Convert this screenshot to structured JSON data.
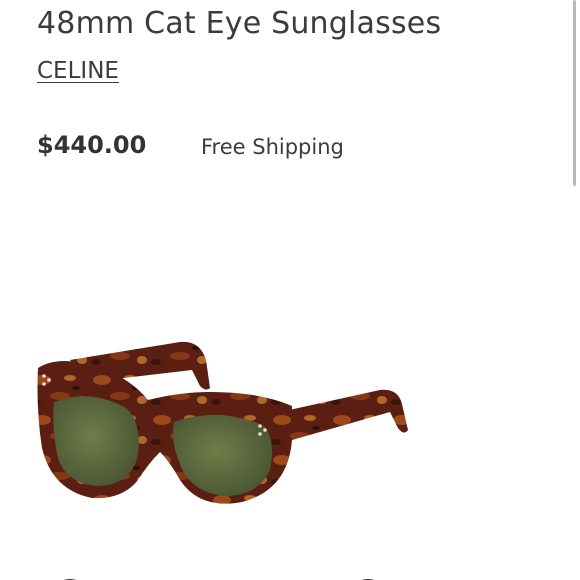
{
  "product": {
    "title": "48mm Cat Eye Sunglasses",
    "brand": "CELINE",
    "price": "$440.00",
    "shipping": "Free Shipping"
  },
  "image": {
    "subject": "sunglasses-icon",
    "frame_color": "#5a1f12",
    "lens_color": "#5b6a3e"
  },
  "colors": {
    "text": "#3b3b3b",
    "background": "#ffffff"
  }
}
